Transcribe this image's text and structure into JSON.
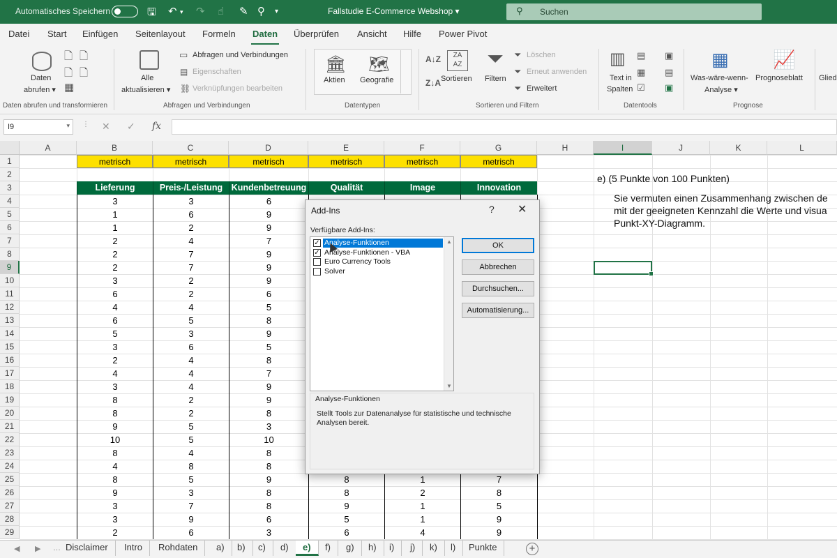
{
  "titlebar": {
    "autosave_label": "Automatisches Speichern",
    "filename": "Fallstudie E-Commerce Webshop  ▾",
    "search_placeholder": "Suchen"
  },
  "menu": [
    "Datei",
    "Start",
    "Einfügen",
    "Seitenlayout",
    "Formeln",
    "Daten",
    "Überprüfen",
    "Ansicht",
    "Hilfe",
    "Power Pivot"
  ],
  "menu_active": "Daten",
  "ribbon": {
    "groups": {
      "g1": "Daten abrufen und transformieren",
      "g2": "Abfragen und Verbindungen",
      "g3": "Datentypen",
      "g4": "Sortieren und Filtern",
      "g5": "Datentools",
      "g6": "Prognose"
    },
    "daten_abrufen": [
      "Daten",
      "abrufen ▾"
    ],
    "alle_aktualisieren": [
      "Alle",
      "aktualisieren ▾"
    ],
    "abfragen_verbindungen": "Abfragen und Verbindungen",
    "eigenschaften": "Eigenschaften",
    "verknuepfungen": "Verknüpfungen bearbeiten",
    "aktien": "Aktien",
    "geografie": "Geografie",
    "sortieren": "Sortieren",
    "filtern": "Filtern",
    "loeschen": "Löschen",
    "erneut_anwenden": "Erneut anwenden",
    "erweitert": "Erweitert",
    "text_in_spalten": [
      "Text in",
      "Spalten"
    ],
    "was_waere_wenn": [
      "Was-wäre-wenn-",
      "Analyse ▾"
    ],
    "prognoseblatt": "Prognoseblatt",
    "gliederung": "Glied"
  },
  "formula_bar": {
    "name_box": "I9",
    "formula": ""
  },
  "columns": [
    "A",
    "B",
    "C",
    "D",
    "E",
    "F",
    "G",
    "H",
    "I",
    "J",
    "K",
    "L"
  ],
  "selected_column": "I",
  "rows": [
    "1",
    "2",
    "3",
    "4",
    "5",
    "6",
    "7",
    "8",
    "9",
    "10",
    "11",
    "12",
    "13",
    "14",
    "15",
    "16",
    "17",
    "18",
    "19",
    "20",
    "21",
    "22",
    "23",
    "24",
    "25",
    "26",
    "27",
    "28",
    "29"
  ],
  "selected_row": "9",
  "sheet": {
    "metric_label": "metrisch",
    "headers": [
      "Lieferung",
      "Preis-/Leistung",
      "Kundenbetreuung",
      "Qualität",
      "Image",
      "Innovation"
    ],
    "data": [
      [
        "3",
        "3",
        "6",
        "",
        "",
        ""
      ],
      [
        "1",
        "6",
        "9",
        "",
        "",
        ""
      ],
      [
        "1",
        "2",
        "9",
        "",
        "",
        ""
      ],
      [
        "2",
        "4",
        "7",
        "",
        "",
        ""
      ],
      [
        "2",
        "7",
        "9",
        "",
        "",
        ""
      ],
      [
        "2",
        "7",
        "9",
        "",
        "",
        ""
      ],
      [
        "3",
        "2",
        "9",
        "",
        "",
        ""
      ],
      [
        "6",
        "2",
        "6",
        "",
        "",
        ""
      ],
      [
        "4",
        "4",
        "5",
        "",
        "",
        ""
      ],
      [
        "6",
        "5",
        "8",
        "",
        "",
        ""
      ],
      [
        "5",
        "3",
        "9",
        "",
        "",
        ""
      ],
      [
        "3",
        "6",
        "5",
        "",
        "",
        ""
      ],
      [
        "2",
        "4",
        "8",
        "",
        "",
        ""
      ],
      [
        "4",
        "4",
        "7",
        "",
        "",
        ""
      ],
      [
        "3",
        "4",
        "9",
        "",
        "",
        ""
      ],
      [
        "8",
        "2",
        "9",
        "",
        "",
        ""
      ],
      [
        "8",
        "2",
        "8",
        "",
        "",
        ""
      ],
      [
        "9",
        "5",
        "3",
        "",
        "",
        ""
      ],
      [
        "10",
        "5",
        "10",
        "",
        "",
        ""
      ],
      [
        "8",
        "4",
        "8",
        "",
        "",
        ""
      ],
      [
        "4",
        "8",
        "8",
        "",
        "",
        ""
      ],
      [
        "8",
        "5",
        "9",
        "8",
        "1",
        "7"
      ],
      [
        "9",
        "3",
        "8",
        "8",
        "2",
        "8"
      ],
      [
        "3",
        "7",
        "8",
        "9",
        "1",
        "5"
      ],
      [
        "3",
        "9",
        "6",
        "5",
        "1",
        "9"
      ],
      [
        "2",
        "6",
        "3",
        "6",
        "4",
        "9"
      ]
    ]
  },
  "task": {
    "heading": "e) (5 Punkte von 100 Punkten)",
    "line1": "Sie vermuten einen Zusammenhang zwischen de",
    "line2": "mit der geeigneten Kennzahl die Werte und visua",
    "line3": "Punkt-XY-Diagramm."
  },
  "dialog": {
    "title": "Add-Ins",
    "help": "?",
    "close": "✕",
    "available_label": "Verfügbare Add-Ins:",
    "addins": [
      {
        "name": "Analyse-Funktionen",
        "checked": true,
        "selected": true
      },
      {
        "name": "Analyse-Funktionen - VBA",
        "checked": true,
        "selected": false
      },
      {
        "name": "Euro Currency Tools",
        "checked": false,
        "selected": false
      },
      {
        "name": "Solver",
        "checked": false,
        "selected": false
      }
    ],
    "buttons": {
      "ok": "OK",
      "cancel": "Abbrechen",
      "browse": "Durchsuchen...",
      "automation": "Automatisierung..."
    },
    "description_title": "Analyse-Funktionen",
    "description_text": "Stellt Tools zur Datenanalyse für statistische und technische Analysen bereit."
  },
  "sheet_tabs": [
    "Disclaimer",
    "Intro",
    "Rohdaten",
    "a)",
    "b)",
    "c)",
    "d)",
    "e)",
    "f)",
    "g)",
    "h)",
    "i)",
    "j)",
    "k)",
    "l)",
    "Punkte"
  ],
  "active_sheet": "e)",
  "colors": {
    "excel_green": "#217346",
    "header_green": "#006a3c",
    "metric_yellow": "#fde000",
    "selection_blue": "#0078d7"
  }
}
